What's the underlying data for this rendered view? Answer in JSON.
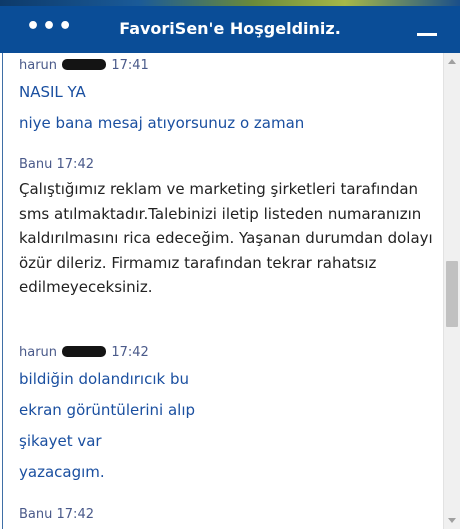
{
  "header": {
    "title": "FavoriSen'e Hoşgeldiniz.",
    "menu_icon": "•••",
    "accent": "#0a4d97"
  },
  "messages": [
    {
      "sender": "harun",
      "time": "17:41",
      "redacted": true,
      "lines": [
        "NASIL YA",
        "niye bana mesaj atıyorsunuz o zaman"
      ]
    },
    {
      "sender": "Banu",
      "time": "17:42",
      "redacted": false,
      "text": "Çalıştığımız reklam ve marketing şirketleri tarafından sms atılmaktadır.Talebinizi iletip listeden numaranızın kaldırılmasını rica edeceğim. Yaşanan durumdan dolayı özür dileriz. Firmamız tarafından tekrar rahatsız edilmeyeceksiniz."
    },
    {
      "sender": "harun",
      "time": "17:42",
      "redacted": true,
      "lines": [
        "bildiğin dolandırıcık bu",
        "ekran görüntülerini alıp",
        "şikayet var",
        "yazacagım."
      ]
    },
    {
      "sender": "Banu",
      "time": "17:42",
      "redacted": false
    }
  ],
  "colors": {
    "user_text": "#1a4fa0",
    "agent_text": "#222222",
    "meta_text": "#4a5a8a"
  }
}
